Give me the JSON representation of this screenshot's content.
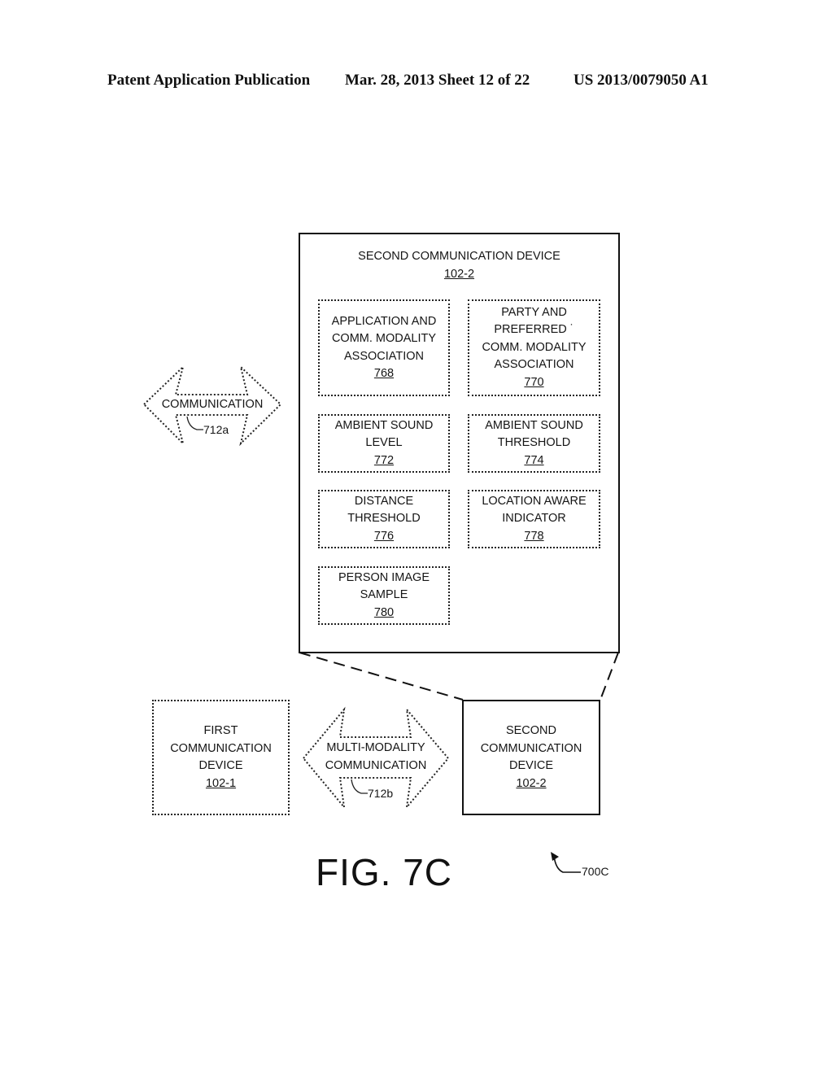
{
  "header": {
    "publication": "Patent Application Publication",
    "date_sheet": "Mar. 28, 2013  Sheet 12 of 22",
    "patent_number": "US 2013/0079050 A1"
  },
  "detail_box": {
    "title": "SECOND COMMUNICATION DEVICE",
    "ref": "102-2",
    "items": [
      {
        "lines": [
          "APPLICATION AND",
          "COMM. MODALITY",
          "ASSOCIATION"
        ],
        "ref": "768"
      },
      {
        "lines": [
          "PARTY AND",
          "PREFERRED ˙",
          "COMM. MODALITY",
          "ASSOCIATION"
        ],
        "ref": "770"
      },
      {
        "lines": [
          "AMBIENT SOUND",
          "LEVEL"
        ],
        "ref": "772"
      },
      {
        "lines": [
          "AMBIENT SOUND",
          "THRESHOLD"
        ],
        "ref": "774"
      },
      {
        "lines": [
          "DISTANCE",
          "THRESHOLD"
        ],
        "ref": "776"
      },
      {
        "lines": [
          "LOCATION AWARE",
          "INDICATOR"
        ],
        "ref": "778"
      },
      {
        "lines": [
          "PERSON IMAGE",
          "SAMPLE"
        ],
        "ref": "780"
      }
    ]
  },
  "communication_arrow": {
    "label": "COMMUNICATION",
    "ref": "712a"
  },
  "first_device": {
    "lines": [
      "FIRST",
      "COMMUNICATION",
      "DEVICE"
    ],
    "ref": "102-1"
  },
  "multi_modality_arrow": {
    "lines": [
      "MULTI-MODALITY",
      "COMMUNICATION"
    ],
    "ref": "712b"
  },
  "second_device": {
    "lines": [
      "SECOND",
      "COMMUNICATION",
      "DEVICE"
    ],
    "ref": "102-2"
  },
  "figure": {
    "label": "FIG. 7C",
    "ref": "700C"
  }
}
